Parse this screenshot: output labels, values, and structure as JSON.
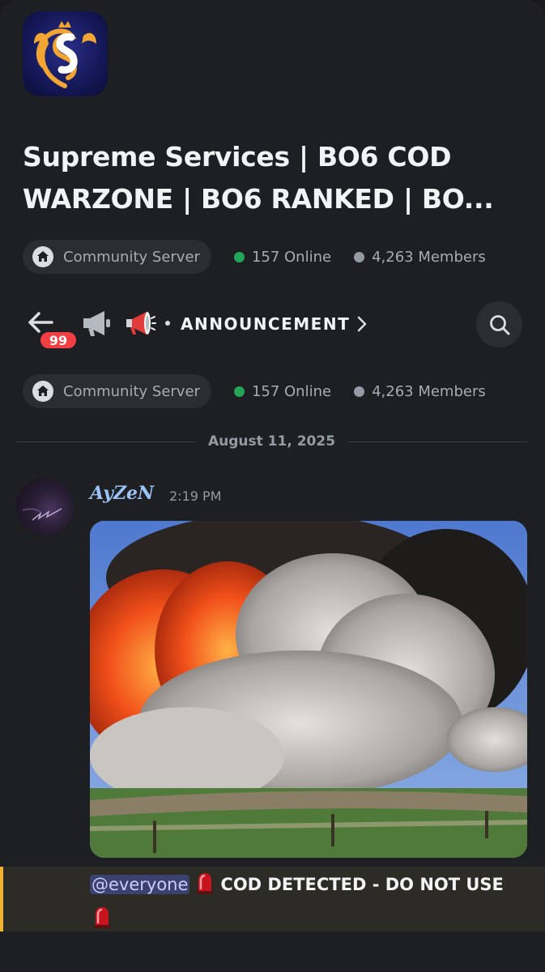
{
  "server": {
    "icon": "swan-s-logo",
    "name": "Supreme Services | BO6 COD WARZONE | BO6 RANKED | BO..."
  },
  "stats": {
    "type_label": "Community Server",
    "online": "157 Online",
    "members": "4,263 Members"
  },
  "channel": {
    "unread_badge": "99",
    "name": "ANNOUNCEMENT"
  },
  "feed": {
    "date": "August 11, 2025"
  },
  "message": {
    "author": "AyZeN",
    "time": "2:19 PM",
    "mention": "@everyone",
    "text": "COD DETECTED - DO NOT USE"
  },
  "colors": {
    "online": "#23a55a",
    "offline": "#949ba4",
    "badge": "#f23f43",
    "highlight_bar": "#f0b232",
    "username": "#9cc3f5"
  }
}
